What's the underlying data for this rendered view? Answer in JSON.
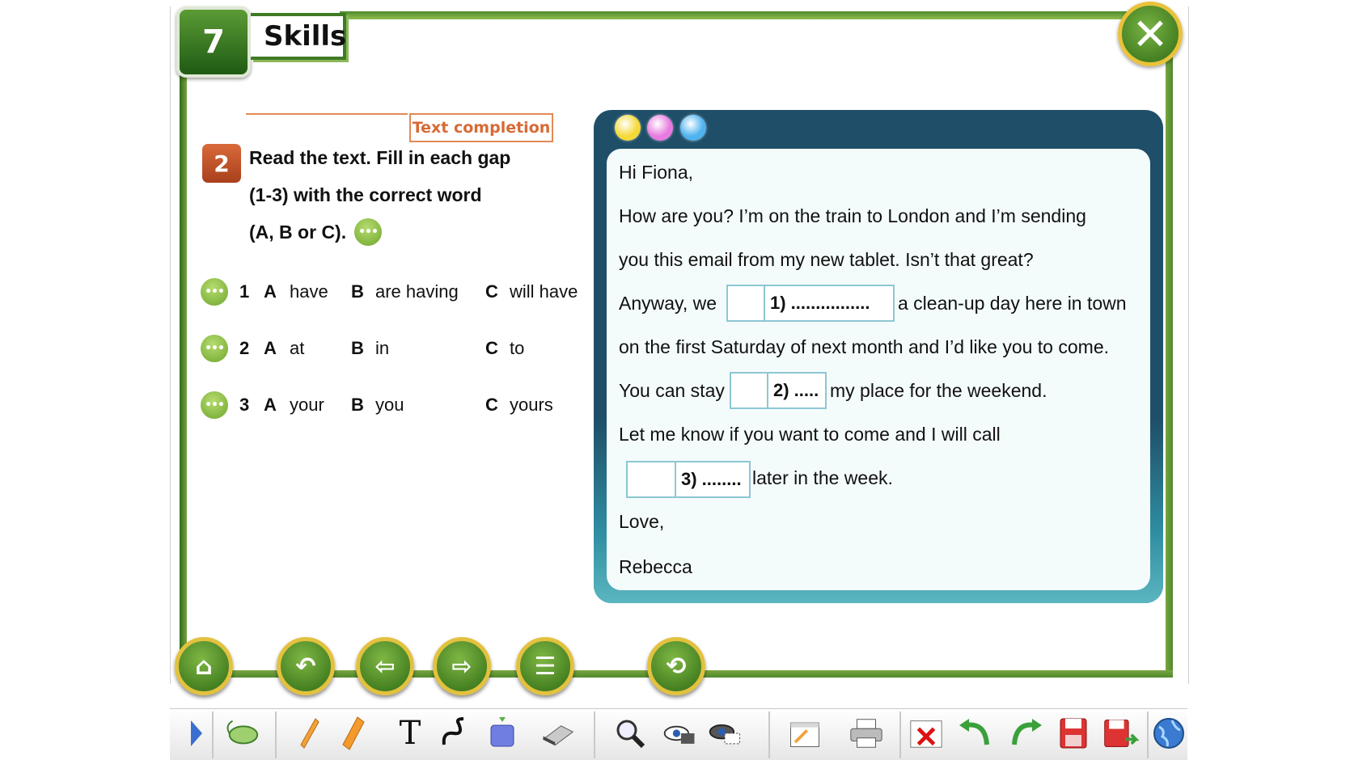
{
  "header": {
    "unit_number": "7",
    "title": "Skills",
    "close_symbol": "✕"
  },
  "exercise": {
    "type_label": "Text completion",
    "number": "2",
    "instructions": [
      "Read the text. Fill in each gap",
      "(1-3) with the correct word",
      "(A, B or C)."
    ],
    "dots": "•••",
    "options": [
      {
        "num": "1",
        "a_letter": "A",
        "a": "have",
        "b_letter": "B",
        "b": "are having",
        "c_letter": "C",
        "c": "will have"
      },
      {
        "num": "2",
        "a_letter": "A",
        "a": "at",
        "b_letter": "B",
        "b": "in",
        "c_letter": "C",
        "c": "to"
      },
      {
        "num": "3",
        "a_letter": "A",
        "a": "your",
        "b_letter": "B",
        "b": "you",
        "c_letter": "C",
        "c": "yours"
      }
    ]
  },
  "letter": {
    "greeting": "Hi Fiona,",
    "line1": "How are you? I’m on the train to London and I’m sending",
    "line2": "you this email from my new tablet. Isn’t that great?",
    "line3_pre": "Anyway, we",
    "gap1": "1) ................",
    "line3_post": "a clean-up day here in town",
    "line4": "on the first Saturday of next month and I’d like you to come.",
    "line5_pre": "You can stay",
    "gap2": "2) .....",
    "line5_post": "my place for the weekend.",
    "line6": "Let me know if you want to come and I will call",
    "gap3": "3) ........",
    "line7_post": "later in the week.",
    "closing": "Love,",
    "signature": "Rebecca",
    "lamp_colors": [
      "#f5d938",
      "#e87be0",
      "#4fb3f0"
    ]
  },
  "nav": {
    "home_icon": "⌂",
    "back_icon": "↶",
    "prev_icon": "⇦",
    "next_icon": "⇨",
    "menu_icon": "☰",
    "refresh_icon": "⟲"
  },
  "toolbar": {
    "icons": [
      "expand-arrow-icon",
      "mouse-icon",
      "pencil-icon",
      "marker-icon",
      "text-tool-icon",
      "freehand-icon",
      "shape-fill-icon",
      "eraser-icon",
      "magnifier-icon",
      "reveal-icon",
      "hide-icon",
      "notepad-icon",
      "print-icon",
      "clear-icon",
      "undo-icon",
      "redo-icon",
      "save-icon",
      "save-as-icon",
      "globe-icon"
    ],
    "text_tool_glyph": "T"
  },
  "colors": {
    "accent_green": "#7aa440",
    "panel_dark": "#1f4f68",
    "orange": "#d76a35",
    "gold": "#e2c13f"
  }
}
